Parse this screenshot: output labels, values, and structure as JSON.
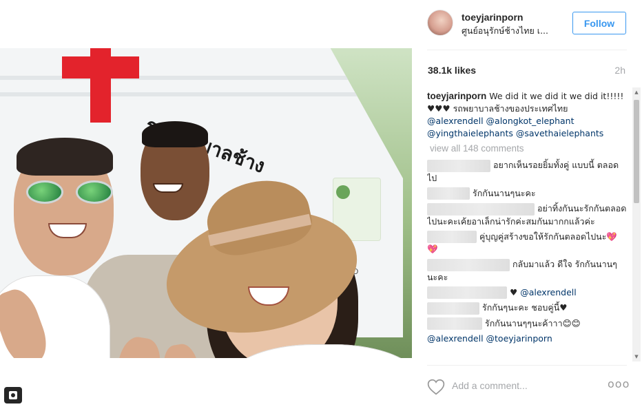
{
  "post": {
    "photo_text": {
      "truck_label": "รถพยาบาลช้าง",
      "truck_brand": "HINO"
    }
  },
  "header": {
    "username": "toeyjarinporn",
    "location": "ศูนย์อนุรักษ์ช้างไทย เ...",
    "follow_label": "Follow"
  },
  "stats": {
    "likes": "38.1k likes",
    "time": "2h"
  },
  "caption": {
    "user": "toeyjarinporn",
    "text": "We did it we did it we did it!!!!! ♥♥♥ รถพยาบาลช้างของประเทศไทย",
    "mentions": [
      "@alexrendell",
      "@alongkot_elephant",
      "@yingthaielephants",
      "@savethaielephants"
    ]
  },
  "view_all_comments": "view all 148 comments",
  "comments": [
    {
      "text": "อยากเห็นรอยยิ้มทั้งคู่ แบบนี้ ตลอดไป"
    },
    {
      "text": "รักกันนานๆนะคะ"
    },
    {
      "text": "อย่าทิ้งกันนะรักกันตลอดไปนะคะเค้ยอาเล็กน่ารักค่ะสมกันมากกแล้วค่ะ"
    },
    {
      "text": "คู่บุญคู่สร้างขอให้รักกันตลอดไปนะ💖💖"
    },
    {
      "text": "กลับมาแล้ว ดีใจ รักกันนานๆนะคะ"
    },
    {
      "text": "♥",
      "mention": "@alexrendell"
    },
    {
      "text": "รักกันๆนะคะ ชอบคู่นี้♥"
    },
    {
      "text": "รักกันนานๆๆนะค้าาา😊😊"
    },
    {
      "text": "@alexrendell @toeyjarinporn"
    }
  ],
  "add_comment": {
    "placeholder": "Add a comment...",
    "more_label": "ooo"
  },
  "colors": {
    "accent": "#3897f0",
    "mention": "#003569",
    "muted": "#a5a7aa",
    "text": "#262626"
  },
  "icons": [
    "heart-icon",
    "more-options-icon",
    "tag-people-icon",
    "scroll-up-icon",
    "scroll-down-icon"
  ]
}
